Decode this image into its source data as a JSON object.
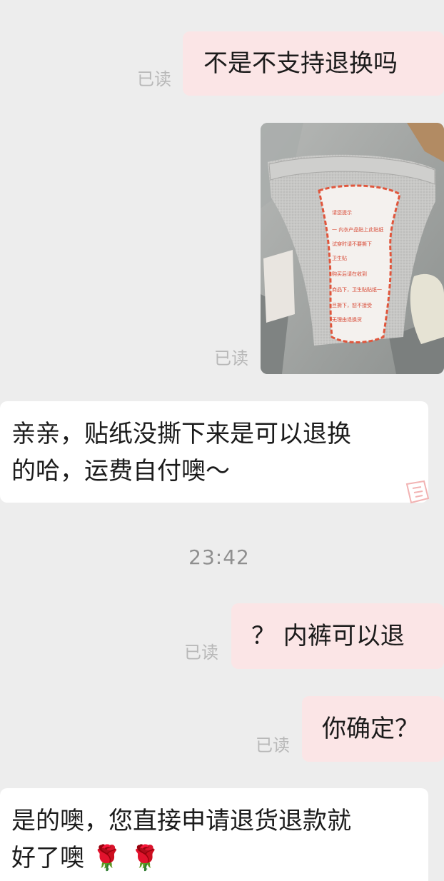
{
  "status": {
    "read_label": "已读"
  },
  "messages": {
    "m1": "不是不支持退换吗",
    "m3_line1": "亲亲，贴纸没撕下来是可以退换",
    "m3_line2": "的哈，运费自付噢～",
    "m4": "？  内裤可以退",
    "m5": "你确定？",
    "m6_line1": "是的噢，您直接申请退货退款就",
    "m6_line2": "好了噢"
  },
  "timestamp": "23:42",
  "photo": {
    "sticker_lines": [
      "请您提示",
      "一  内衣产品贴上此贴纸",
      "试穿时请不要撕下",
      "卫生贴",
      "购买后请在收到",
      "商品下，卫生贴贴纸一",
      "旦撕下，恕不接受",
      "无理由退换货"
    ]
  },
  "emoji": {
    "rose": "🌹"
  },
  "colors": {
    "background": "#ededed",
    "outgoing_bubble": "#fbe5e6",
    "incoming_bubble": "#ffffff",
    "read_text": "#b8b8b8",
    "timestamp_text": "#8f8f8f"
  }
}
